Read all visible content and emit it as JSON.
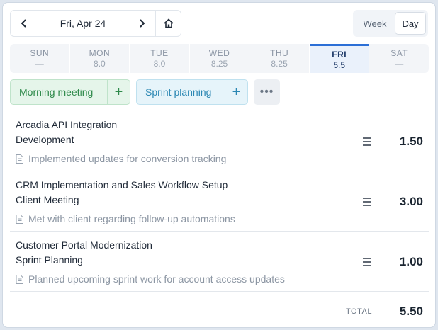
{
  "date_nav": {
    "date_label": "Fri, Apr 24"
  },
  "view_toggle": {
    "week_label": "Week",
    "day_label": "Day",
    "selected": "Day"
  },
  "week": [
    {
      "day": "SUN",
      "hours": "—"
    },
    {
      "day": "MON",
      "hours": "8.0"
    },
    {
      "day": "TUE",
      "hours": "8.0"
    },
    {
      "day": "WED",
      "hours": "8.25"
    },
    {
      "day": "THU",
      "hours": "8.25"
    },
    {
      "day": "FRI",
      "hours": "5.5"
    },
    {
      "day": "SAT",
      "hours": "—"
    }
  ],
  "quick_add": {
    "morning_label": "Morning meeting",
    "sprint_label": "Sprint planning",
    "plus": "+",
    "more": "•••"
  },
  "entries": [
    {
      "project": "Arcadia API Integration",
      "task": "Development",
      "note": "Implemented updates for conversion tracking",
      "hours": "1.50"
    },
    {
      "project": "CRM Implementation and Sales Workflow Setup",
      "task": "Client Meeting",
      "note": "Met with client regarding follow-up automations",
      "hours": "3.00"
    },
    {
      "project": "Customer Portal Modernization",
      "task": "Sprint Planning",
      "note": "Planned upcoming sprint work for account access updates",
      "hours": "1.00"
    }
  ],
  "total": {
    "label": "TOTAL",
    "value": "5.50"
  },
  "icons": [
    "chevron-left-icon",
    "chevron-right-icon",
    "home-icon",
    "plus-icon",
    "more-icon",
    "document-icon",
    "hamburger-menu-icon"
  ],
  "colors": {
    "active_day_accent": "#2c6fd6",
    "morning_green": "#2f8a4b",
    "sprint_blue": "#2b87b3"
  }
}
